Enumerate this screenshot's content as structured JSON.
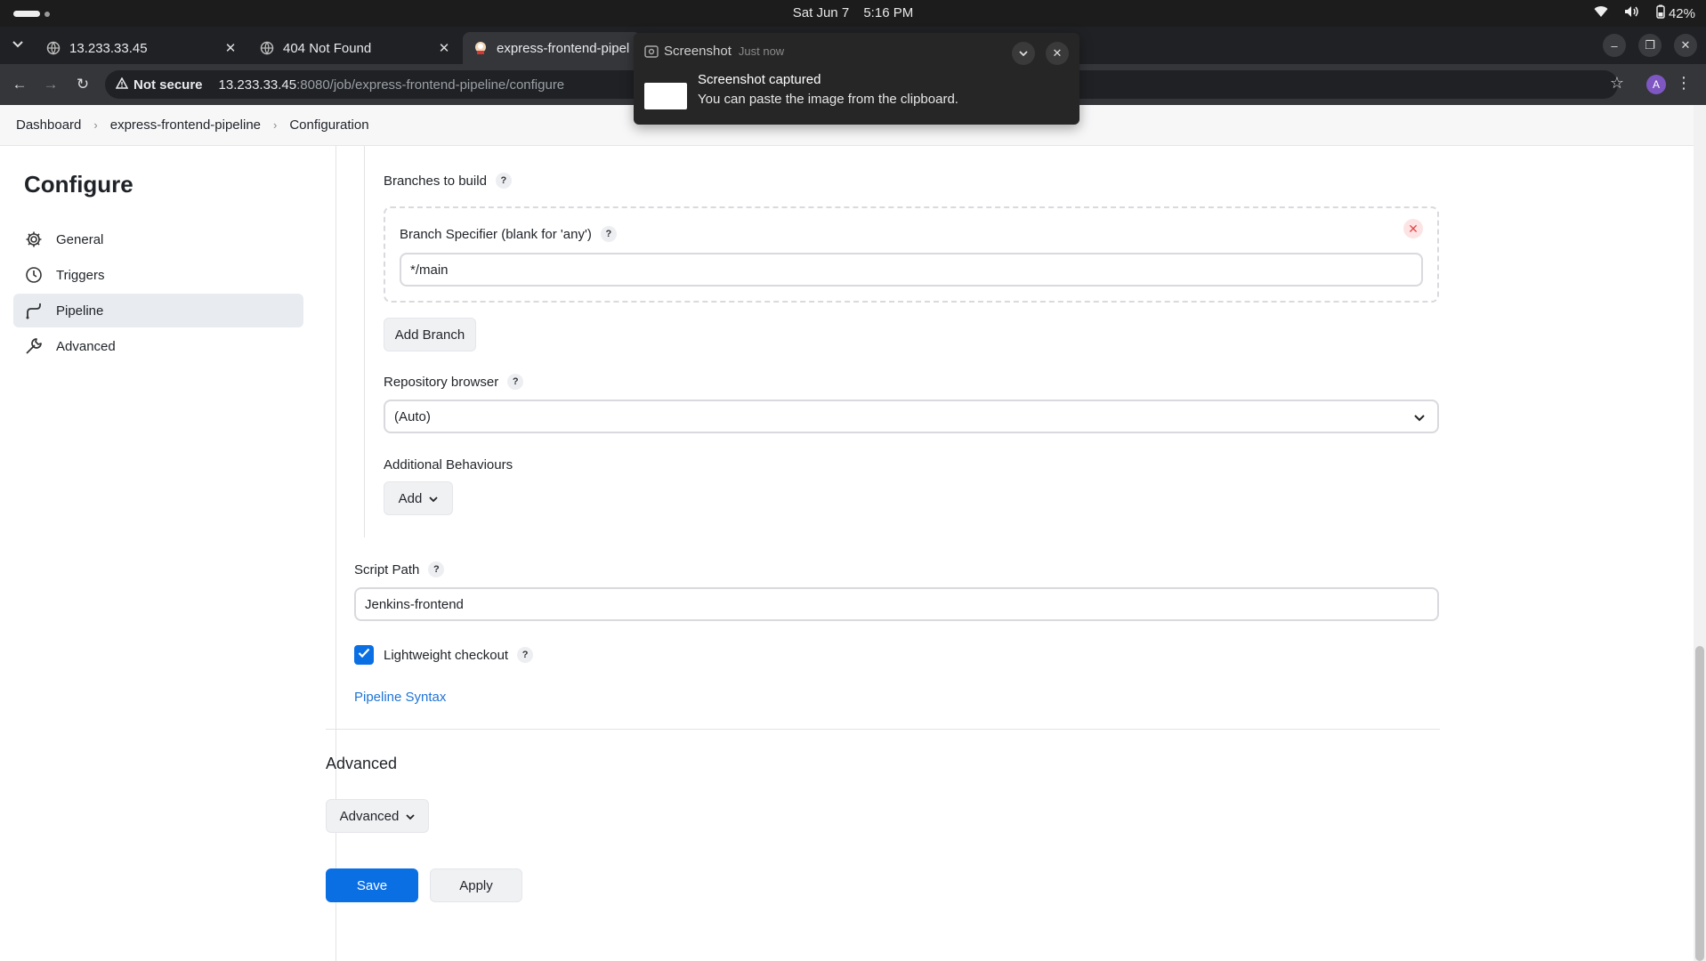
{
  "os": {
    "date": "Sat Jun 7",
    "time": "5:16 PM",
    "battery": "42%"
  },
  "tabs": [
    {
      "title": "13.233.33.45"
    },
    {
      "title": "404 Not Found"
    },
    {
      "title": "express-frontend-pipeline"
    }
  ],
  "address": {
    "security": "Not secure",
    "host": "13.233.33.45",
    "path": ":8080/job/express-frontend-pipeline/configure",
    "avatar_letter": "A"
  },
  "notification": {
    "app": "Screenshot",
    "when": "Just now",
    "title": "Screenshot captured",
    "body": "You can paste the image from the clipboard."
  },
  "breadcrumb": {
    "items": [
      "Dashboard",
      "express-frontend-pipeline",
      "Configuration"
    ]
  },
  "sidebar": {
    "title": "Configure",
    "items": [
      {
        "label": "General",
        "icon": "gear-icon"
      },
      {
        "label": "Triggers",
        "icon": "clock-icon"
      },
      {
        "label": "Pipeline",
        "icon": "pipeline-icon",
        "active": true
      },
      {
        "label": "Advanced",
        "icon": "wrench-icon"
      }
    ]
  },
  "form": {
    "branches_label": "Branches to build",
    "branch_specifier_label": "Branch Specifier (blank for 'any')",
    "branch_specifier_value": "*/main",
    "add_branch": "Add Branch",
    "repo_browser_label": "Repository browser",
    "repo_browser_value": "(Auto)",
    "additional_behaviours_label": "Additional Behaviours",
    "add_label": "Add",
    "script_path_label": "Script Path",
    "script_path_value": "Jenkins-frontend",
    "lightweight_label": "Lightweight checkout",
    "lightweight_checked": true,
    "pipeline_syntax": "Pipeline Syntax",
    "advanced_section_title": "Advanced",
    "advanced_button": "Advanced",
    "save": "Save",
    "apply": "Apply"
  }
}
